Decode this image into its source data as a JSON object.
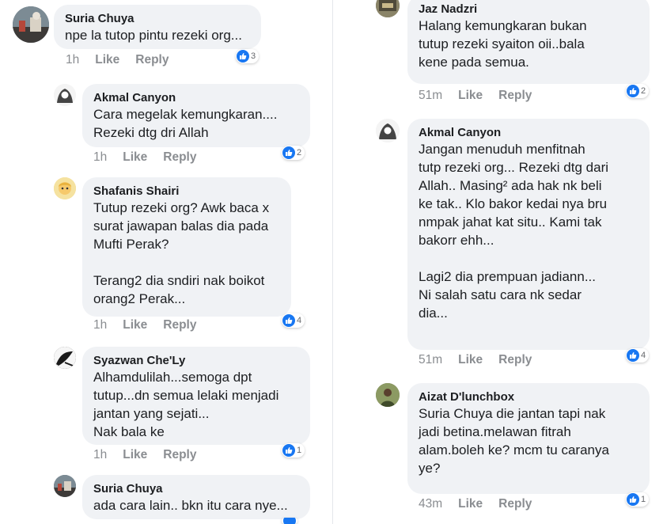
{
  "left_column": {
    "comments": [
      {
        "author": "Suria Chuya",
        "text": "npe la tutop pintu rezeki org...",
        "time": "1h",
        "like_label": "Like",
        "reply_label": "Reply",
        "reaction_count": "3"
      },
      {
        "author": "Akmal Canyon",
        "text": "Cara megelak kemungkaran....\nRezeki dtg dri Allah",
        "time": "1h",
        "like_label": "Like",
        "reply_label": "Reply",
        "reaction_count": "2"
      },
      {
        "author": "Shafanis Shairi",
        "text": "Tutup rezeki org? Awk baca x\nsurat jawapan balas dia pada\nMufti Perak?\n\nTerang2 dia sndiri nak boikot\norang2 Perak...",
        "time": "1h",
        "like_label": "Like",
        "reply_label": "Reply",
        "reaction_count": "4"
      },
      {
        "author": "Syazwan Che'Ly",
        "text": "Alhamdulilah...semoga dpt\ntutup...dn semua lelaki menjadi\njantan yang sejati...\nNak bala ke",
        "time": "1h",
        "like_label": "Like",
        "reply_label": "Reply",
        "reaction_count": "1"
      },
      {
        "author": "Suria Chuya",
        "text": "ada cara lain.. bkn itu cara nye...",
        "time": "",
        "like_label": "",
        "reply_label": "",
        "reaction_count": ""
      }
    ]
  },
  "right_column": {
    "comments": [
      {
        "author": "Jaz Nadzri",
        "text": "Halang kemungkaran bukan\ntutup rezeki syaiton oii..bala\nkene pada semua.",
        "time": "51m",
        "like_label": "Like",
        "reply_label": "Reply",
        "reaction_count": "2"
      },
      {
        "author": "Akmal Canyon",
        "text": "Jangan menuduh menfitnah\ntutp rezeki org...  Rezeki dtg dari\nAllah..  Masing² ada hak nk beli\nke tak..  Klo bakor kedai nya bru\nnmpak jahat kat situ..  Kami tak\nbakorr ehh...\n\nLagi2 dia prempuan jadiann...\nNi salah satu cara nk sedar\ndia...",
        "time": "51m",
        "like_label": "Like",
        "reply_label": "Reply",
        "reaction_count": "4"
      },
      {
        "author": "Aizat D'lunchbox",
        "text": "Suria Chuya die jantan tapi nak\njadi betina.melawan fitrah\nalam.boleh ke? mcm tu caranya\nye?",
        "time": "43m",
        "like_label": "Like",
        "reply_label": "Reply",
        "reaction_count": "1"
      }
    ]
  },
  "colors": {
    "bubble": "#f0f2f5",
    "like_blue": "#1877f2",
    "meta_gray": "#8a8d91"
  },
  "icons": {
    "reaction": "thumbs-up-icon",
    "avatar": "profile-photo"
  }
}
